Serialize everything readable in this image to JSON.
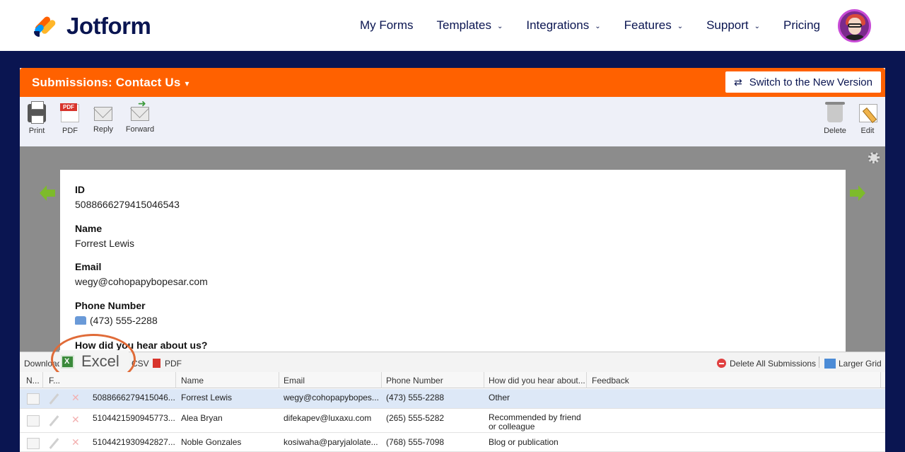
{
  "brand": {
    "name": "Jotform"
  },
  "nav": {
    "items": [
      {
        "label": "My Forms",
        "dropdown": false
      },
      {
        "label": "Templates",
        "dropdown": true
      },
      {
        "label": "Integrations",
        "dropdown": true
      },
      {
        "label": "Features",
        "dropdown": true
      },
      {
        "label": "Support",
        "dropdown": true
      },
      {
        "label": "Pricing",
        "dropdown": false
      }
    ],
    "chevron": "⌄"
  },
  "submissions": {
    "title": "Submissions: Contact Us",
    "caret": "▾",
    "switch_label": "Switch to the New Version",
    "switch_icon": "⇄"
  },
  "toolbar": {
    "print": "Print",
    "pdf": "PDF",
    "reply": "Reply",
    "forward": "Forward",
    "delete": "Delete",
    "edit": "Edit"
  },
  "record": {
    "id_label": "ID",
    "id_value": "5088666279415046543",
    "name_label": "Name",
    "name_value": "Forrest Lewis",
    "email_label": "Email",
    "email_value": "wegy@cohopapybopesar.com",
    "phone_label": "Phone Number",
    "phone_value": "(473) 555-2288",
    "hear_label": "How did you hear about us?"
  },
  "gridbar": {
    "download_label": "Download as:",
    "csv_label": "CSV",
    "pdf_label": "PDF",
    "excel_label": "Excel",
    "delete_all": "Delete All Submissions",
    "larger_grid": "Larger Grid"
  },
  "table": {
    "headers": [
      "N...",
      "F...",
      "",
      "Name",
      "Email",
      "Phone Number",
      "How did you hear about...",
      "Feedback"
    ],
    "rows": [
      {
        "id": "5088666279415046...",
        "name": "Forrest Lewis",
        "email": "wegy@cohopapybopes...",
        "phone": "(473) 555-2288",
        "hear": "Other",
        "feedback": ""
      },
      {
        "id": "5104421590945773...",
        "name": "Alea Bryan",
        "email": "difekapev@luxaxu.com",
        "phone": "(265) 555-5282",
        "hear": "Recommended by friend or colleague",
        "feedback": ""
      },
      {
        "id": "5104421930942827...",
        "name": "Noble Gonzales",
        "email": "kosiwaha@paryjalolate...",
        "phone": "(768) 555-7098",
        "hear": "Blog or publication",
        "feedback": ""
      }
    ]
  },
  "colors": {
    "brand_orange": "#ff6100",
    "navy": "#0a1551",
    "selected_row": "#dde8f7",
    "callout": "#e06b38"
  }
}
